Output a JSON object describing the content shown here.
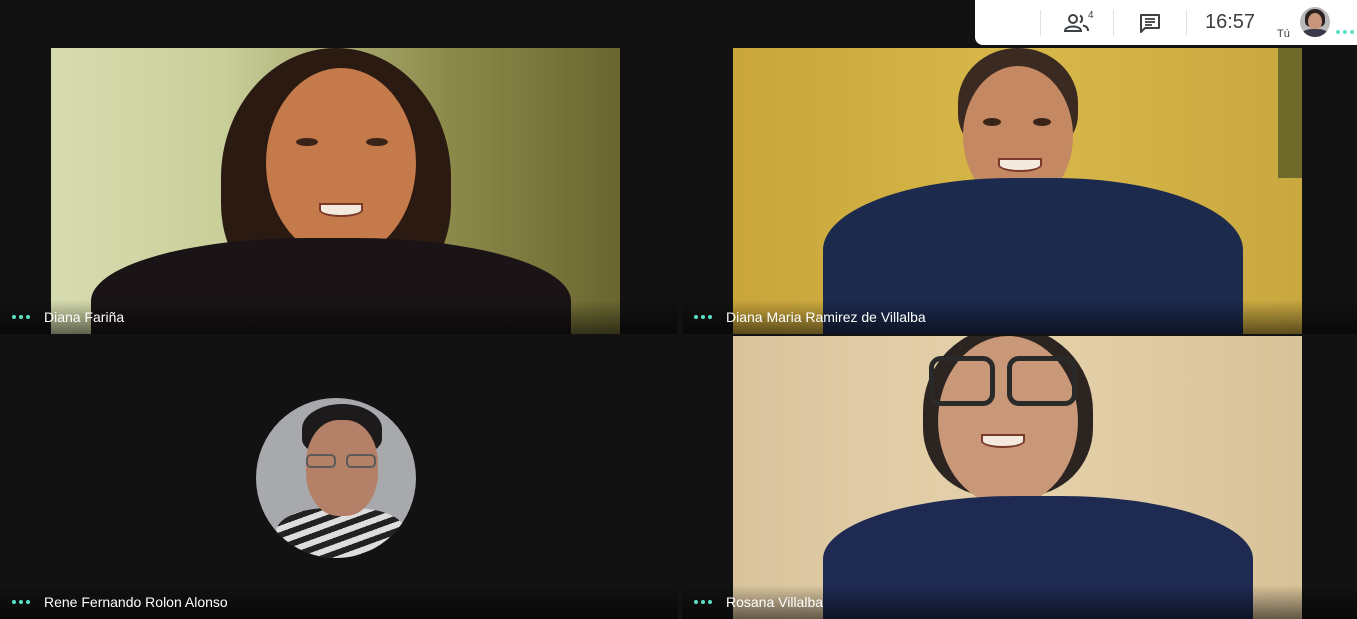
{
  "participants": [
    {
      "name": "Diana Fariña"
    },
    {
      "name": "Diana Maria Ramirez de Villalba"
    },
    {
      "name": "Rene Fernando Rolon Alonso"
    },
    {
      "name": "Rosana Villalba"
    }
  ],
  "topbar": {
    "people_count": "4",
    "time": "16:57",
    "self_label": "Tú"
  },
  "colors": {
    "background": "#121212",
    "accent_dots": "#5ce1c6",
    "topbar": "#ffffff"
  },
  "icons": [
    "people-icon",
    "chat-icon",
    "more-options-icon"
  ]
}
